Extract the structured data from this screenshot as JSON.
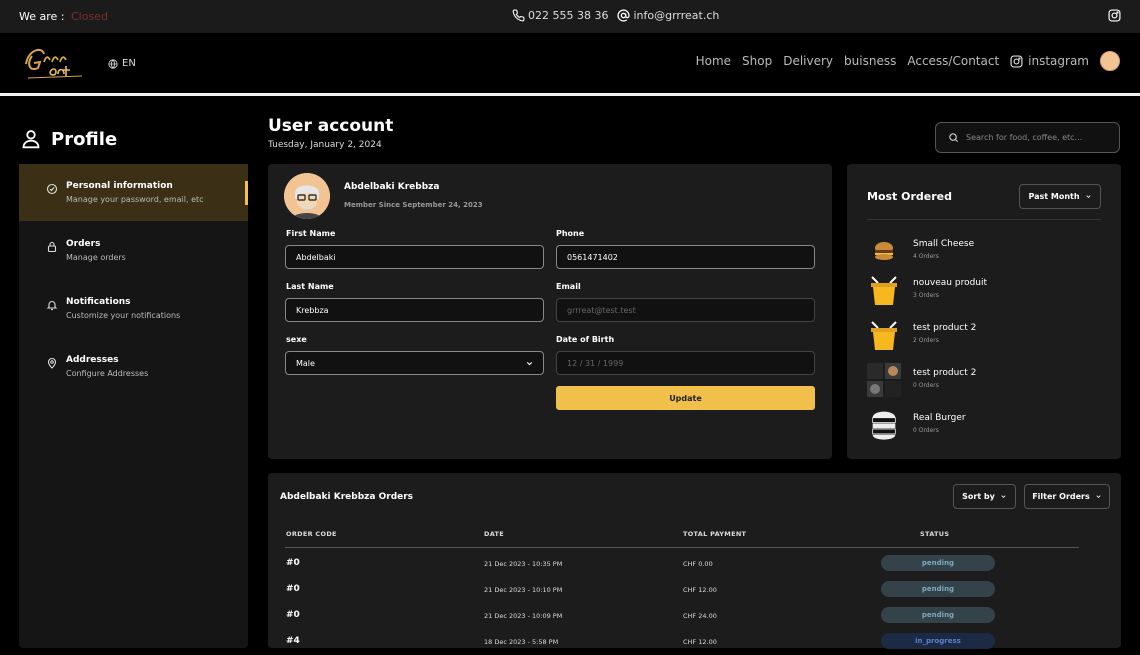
{
  "topbar": {
    "status_label": "We are :",
    "status_value": "Closed",
    "phone": "022 555 38 36",
    "email": "info@grrreat.ch"
  },
  "navbar": {
    "logo_text": "Grrr eat",
    "lang": "EN",
    "links": [
      "Home",
      "Shop",
      "Delivery",
      "buisness",
      "Access/Contact",
      "instagram"
    ]
  },
  "profile": {
    "title": "Profile"
  },
  "sidebar": {
    "items": [
      {
        "title": "Personal information",
        "subtitle": "Manage your password, email, etc",
        "icon": "settings-icon"
      },
      {
        "title": "Orders",
        "subtitle": "Manage orders",
        "icon": "lock-icon"
      },
      {
        "title": "Notifications",
        "subtitle": "Customize your notifications",
        "icon": "bell-icon"
      },
      {
        "title": "Addresses",
        "subtitle": "Configure Addresses",
        "icon": "location-icon"
      }
    ]
  },
  "account": {
    "title": "User account",
    "date": "Tuesday, January 2, 2024",
    "search_placeholder": "Search for food, coffee, etc..."
  },
  "user": {
    "name": "Abdelbaki Krebbza",
    "member_since": "Member Since September 24, 2023"
  },
  "form": {
    "first_name_label": "First Name",
    "first_name_value": "Abdelbaki",
    "phone_label": "Phone",
    "phone_value": "0561471402",
    "last_name_label": "Last Name",
    "last_name_value": "Krebbza",
    "email_label": "Email",
    "email_placeholder": "grrreat@test.test",
    "sexe_label": "sexe",
    "sexe_value": "Male",
    "dob_label": "Date of Birth",
    "dob_placeholder": "12 / 31 / 1999",
    "update_label": "Update"
  },
  "most_ordered": {
    "title": "Most Ordered",
    "period": "Past Month",
    "items": [
      {
        "name": "Small Cheese",
        "count": "4 Orders"
      },
      {
        "name": "nouveau produit",
        "count": "3 Orders"
      },
      {
        "name": "test product 2",
        "count": "2 Orders"
      },
      {
        "name": "test product 2",
        "count": "0 Orders"
      },
      {
        "name": "Real Burger",
        "count": "0 Orders"
      }
    ]
  },
  "orders": {
    "title": "Abdelbaki Krebbza Orders",
    "sort_label": "Sort by",
    "filter_label": "Filter Orders",
    "columns": [
      "ORDER CODE",
      "DATE",
      "TOTAL PAYMENT",
      "STATUS"
    ],
    "rows": [
      {
        "code": "#0",
        "date": "21 Dec 2023 - 10:35 PM",
        "total": "CHF 0.00",
        "status": "pending"
      },
      {
        "code": "#0",
        "date": "21 Dec 2023 - 10:10 PM",
        "total": "CHF 12.00",
        "status": "pending"
      },
      {
        "code": "#0",
        "date": "21 Dec 2023 - 10:09 PM",
        "total": "CHF 24.00",
        "status": "pending"
      },
      {
        "code": "#4",
        "date": "18 Dec 2023 - 5:58 PM",
        "total": "CHF 12.00",
        "status": "in_progress"
      }
    ]
  },
  "colors": {
    "accent": "#f0c04a",
    "closed": "#7a2e2e",
    "pending_badge": "#34434a",
    "progress_badge": "#1c2a44"
  }
}
